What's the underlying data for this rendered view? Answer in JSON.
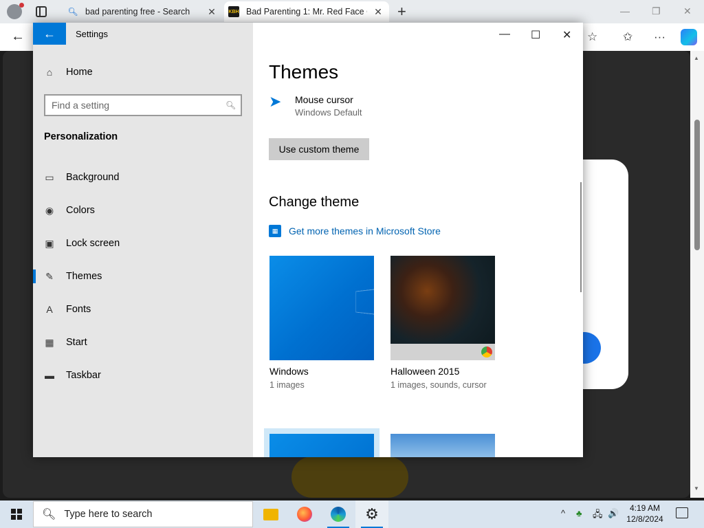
{
  "browser": {
    "tabs": [
      {
        "title": "bad parenting free - Search",
        "close": "✕"
      },
      {
        "title": "Bad Parenting 1: Mr. Red Face On",
        "favicon_text": "KBH",
        "close": "✕"
      }
    ],
    "new_tab": "+",
    "window_controls": {
      "minimize": "—",
      "restore": "❐",
      "close": "✕"
    },
    "toolbar": {
      "back": "←",
      "favorite": "☆",
      "favorites": "✩",
      "more": "···"
    }
  },
  "settings": {
    "window_title": "Settings",
    "back_glyph": "←",
    "controls": {
      "minimize": "—",
      "maximize": "☐",
      "close": "✕"
    },
    "sidebar": {
      "home_label": "Home",
      "search_placeholder": "Find a setting",
      "section_title": "Personalization",
      "items": [
        {
          "label": "Background",
          "icon": "image-icon",
          "glyph": "▭",
          "active": false
        },
        {
          "label": "Colors",
          "icon": "palette-icon",
          "glyph": "◉",
          "active": false
        },
        {
          "label": "Lock screen",
          "icon": "lock-screen-icon",
          "glyph": "▣",
          "active": false
        },
        {
          "label": "Themes",
          "icon": "brush-icon",
          "glyph": "✎",
          "active": true
        },
        {
          "label": "Fonts",
          "icon": "font-icon",
          "glyph": "A",
          "active": false
        },
        {
          "label": "Start",
          "icon": "start-icon",
          "glyph": "▦",
          "active": false
        },
        {
          "label": "Taskbar",
          "icon": "taskbar-icon",
          "glyph": "▬",
          "active": false
        }
      ]
    },
    "main": {
      "heading": "Themes",
      "cursor": {
        "name": "Mouse cursor",
        "value": "Windows Default"
      },
      "custom_theme_button": "Use custom theme",
      "change_theme_heading": "Change theme",
      "store_link": "Get more themes in Microsoft Store",
      "themes": [
        {
          "name": "Windows",
          "detail": "1 images"
        },
        {
          "name": "Halloween 2015",
          "detail": "1 images, sounds, cursor"
        }
      ]
    }
  },
  "taskbar": {
    "search_placeholder": "Type here to search",
    "apps": [
      "File Explorer",
      "Firefox",
      "Microsoft Edge",
      "Settings"
    ],
    "tray": {
      "chevron": "^",
      "network": "🖧",
      "volume": "🔊"
    },
    "time": "4:19 AM",
    "date": "12/8/2024"
  }
}
